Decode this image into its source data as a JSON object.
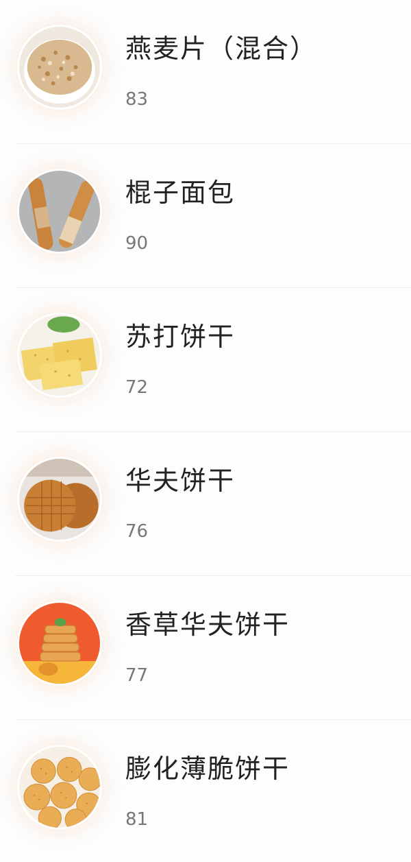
{
  "items": [
    {
      "name": "燕麦片（混合）",
      "value": "83",
      "image": "oatmeal-image"
    },
    {
      "name": "棍子面包",
      "value": "90",
      "image": "baguette-image"
    },
    {
      "name": "苏打饼干",
      "value": "72",
      "image": "soda-cracker-image"
    },
    {
      "name": "华夫饼干",
      "value": "76",
      "image": "waffle-cookie-image"
    },
    {
      "name": "香草华夫饼干",
      "value": "77",
      "image": "vanilla-waffle-image"
    },
    {
      "name": "膨化薄脆饼干",
      "value": "81",
      "image": "puffed-cracker-image"
    }
  ]
}
